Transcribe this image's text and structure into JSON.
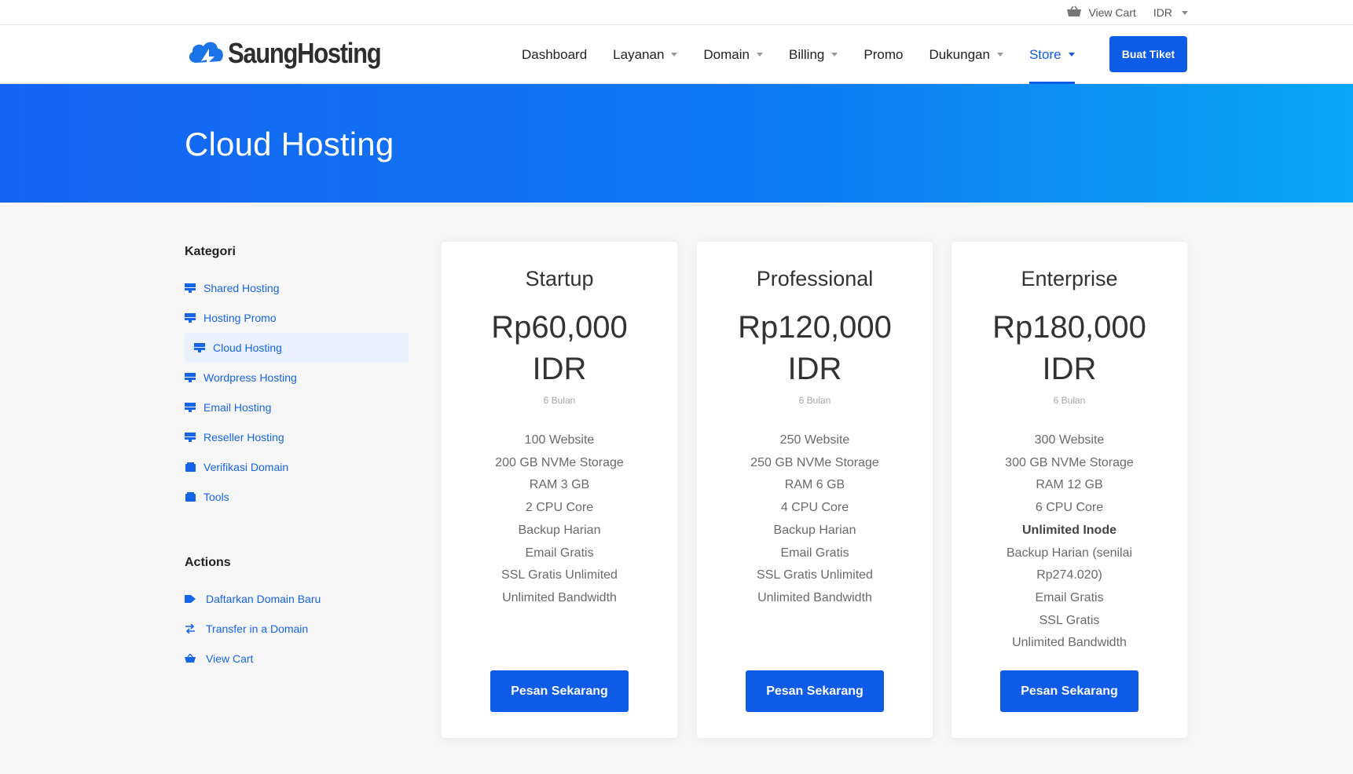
{
  "topbar": {
    "cart_label": "View Cart",
    "currency": "IDR"
  },
  "brand": {
    "name": "SaungHosting"
  },
  "nav": {
    "items": [
      {
        "label": "Dashboard",
        "dropdown": false
      },
      {
        "label": "Layanan",
        "dropdown": true
      },
      {
        "label": "Domain",
        "dropdown": true
      },
      {
        "label": "Billing",
        "dropdown": true
      },
      {
        "label": "Promo",
        "dropdown": false
      },
      {
        "label": "Dukungan",
        "dropdown": true
      },
      {
        "label": "Store",
        "dropdown": true,
        "active": true
      }
    ],
    "cta_label": "Buat Tiket"
  },
  "hero": {
    "title": "Cloud Hosting"
  },
  "sidebar": {
    "categories_title": "Kategori",
    "categories": [
      {
        "label": "Shared Hosting",
        "icon": "server-icon"
      },
      {
        "label": "Hosting Promo",
        "icon": "server-icon"
      },
      {
        "label": "Cloud Hosting",
        "icon": "server-icon",
        "active": true
      },
      {
        "label": "Wordpress Hosting",
        "icon": "server-icon"
      },
      {
        "label": "Email Hosting",
        "icon": "server-icon"
      },
      {
        "label": "Reseller Hosting",
        "icon": "server-icon"
      },
      {
        "label": "Verifikasi Domain",
        "icon": "box-icon"
      },
      {
        "label": "Tools",
        "icon": "box-icon"
      }
    ],
    "actions_title": "Actions",
    "actions": [
      {
        "label": "Daftarkan Domain Baru",
        "icon": "tag-icon"
      },
      {
        "label": "Transfer in a Domain",
        "icon": "transfer-icon"
      },
      {
        "label": "View Cart",
        "icon": "cart-icon"
      }
    ]
  },
  "plans": [
    {
      "name": "Startup",
      "price": "Rp60,000",
      "currency": "IDR",
      "period": "6 Bulan",
      "features": [
        "100 Website",
        "200 GB NVMe Storage",
        "RAM 3 GB",
        "2 CPU Core",
        "Backup Harian",
        "Email Gratis",
        "SSL Gratis Unlimited",
        "Unlimited Bandwidth"
      ],
      "button": "Pesan Sekarang"
    },
    {
      "name": "Professional",
      "price": "Rp120,000",
      "currency": "IDR",
      "period": "6 Bulan",
      "features": [
        "250 Website",
        "250 GB NVMe Storage",
        "RAM 6 GB",
        "4 CPU Core",
        "Backup Harian",
        "Email Gratis",
        "SSL Gratis Unlimited",
        "Unlimited Bandwidth"
      ],
      "button": "Pesan Sekarang"
    },
    {
      "name": "Enterprise",
      "price": "Rp180,000",
      "currency": "IDR",
      "period": "6 Bulan",
      "features": [
        "300 Website",
        "300 GB NVMe Storage",
        "RAM 12 GB",
        "6 CPU Core",
        "Unlimited Inode",
        "Backup Harian (senilai Rp274.020)",
        "Email Gratis",
        "SSL Gratis",
        "Unlimited Bandwidth"
      ],
      "bold_feature": "Unlimited Inode",
      "button": "Pesan Sekarang"
    }
  ],
  "colors": {
    "accent": "#0e5be8",
    "hero_start": "#1565f2",
    "hero_end": "#0aa6f8"
  }
}
